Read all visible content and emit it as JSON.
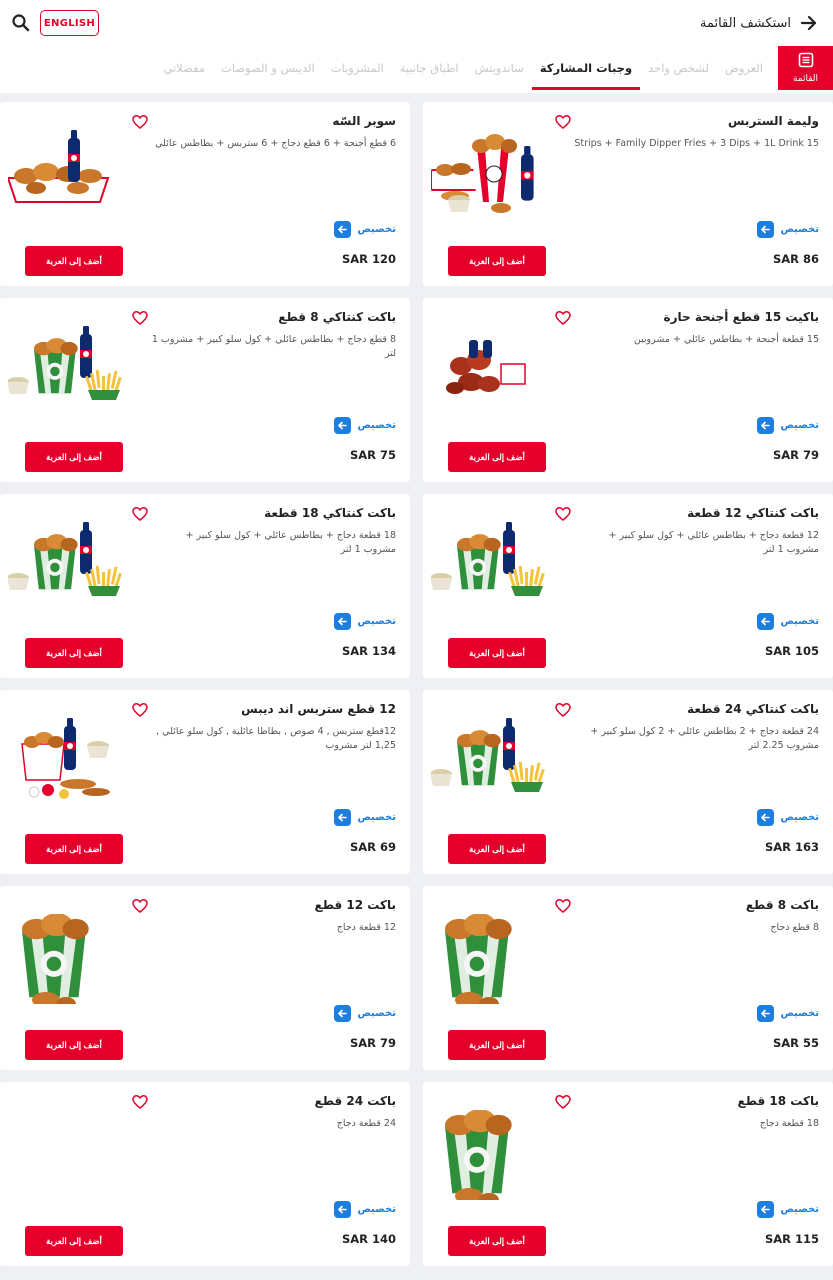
{
  "header": {
    "language_button": "ENGLISH",
    "explore_label": "استكشف القائمة"
  },
  "nav": {
    "menu_label": "القائمة",
    "tabs": [
      {
        "label": "العروض"
      },
      {
        "label": "لشخص واحد"
      },
      {
        "label": "وجبات المشاركة"
      },
      {
        "label": "ساندويتش"
      },
      {
        "label": "اطباق جانبية"
      },
      {
        "label": "المشروبات"
      },
      {
        "label": "الديبس و الصوصات"
      },
      {
        "label": "مفضلاتي"
      }
    ],
    "active_tab": "وجبات المشاركة"
  },
  "products": [
    {
      "title": "وليمة الستربس",
      "desc": "15 Strips + Family Dipper Fries + 3 Dips + 1L Drink",
      "price": "SAR 86",
      "image": "bucket-meal-drink"
    },
    {
      "title": "سوبر السّه",
      "desc": "6 قطع أجنحة + 6 قطع دجاج + 6 ستربس + بطاطس عائلي",
      "price": "SAR 120",
      "image": "fried-tray-drink"
    },
    {
      "title": "باكيت 15 قطع أجنحة حارة",
      "desc": "15 قطعة أجنحة + بطاطس عائلي + مشروبين",
      "price": "SAR 79",
      "image": "hot-wings"
    },
    {
      "title": "باكت كنتاكي 8 قطع",
      "desc": "8 قطع دجاج + بطاطس عائلي + كول سلو كبير + مشروب 1 لتر",
      "price": "SAR 75",
      "image": "bucket-combo"
    },
    {
      "title": "باكت كنتاكي 12 قطعة",
      "desc": "12 قطعة دجاج + بطاطس عائلي + كول سلو كبير + مشروب 1 لتر",
      "price": "SAR 105",
      "image": "bucket-combo"
    },
    {
      "title": "باكت كنتاكي 18 قطعة",
      "desc": "18 قطعة دجاج + بطاطس عائلي + كول سلو كبير + مشروب 1 لتر",
      "price": "SAR 134",
      "image": "bucket-combo"
    },
    {
      "title": "باكت كنتاكي 24 قطعة",
      "desc": "24 قطعة دجاج + 2 بطاطس عائلي + 2 كول سلو كبير + مشروب 2.25 لتر",
      "price": "SAR 163",
      "image": "bucket-combo"
    },
    {
      "title": "12 قطع ستربس اند ديبس",
      "desc": "12قطع ستربس , 4 صوص , بطاطا عائلية , كول سلو عائلي , 1,25 لتر مشروب",
      "price": "SAR 69",
      "image": "strips-dips"
    },
    {
      "title": "باكت 8 قطع",
      "desc": "8 قطع دجاج",
      "price": "SAR 55",
      "image": "bucket-only"
    },
    {
      "title": "باكت 12 قطع",
      "desc": "12 قطعة دجاج",
      "price": "SAR 79",
      "image": "bucket-only"
    },
    {
      "title": "باكت 18 قطع",
      "desc": "18 قطعة دجاج",
      "price": "SAR 115",
      "image": "bucket-only"
    },
    {
      "title": "باكت 24 قطع",
      "desc": "24 قطعة دجاج",
      "price": "SAR 140",
      "image": "none"
    }
  ],
  "labels": {
    "customize": "تخصيص",
    "add_to_cart": "أضف إلى العربة"
  },
  "colors": {
    "brand_red": "#e4002b",
    "accent_blue": "#1c7fe0"
  }
}
